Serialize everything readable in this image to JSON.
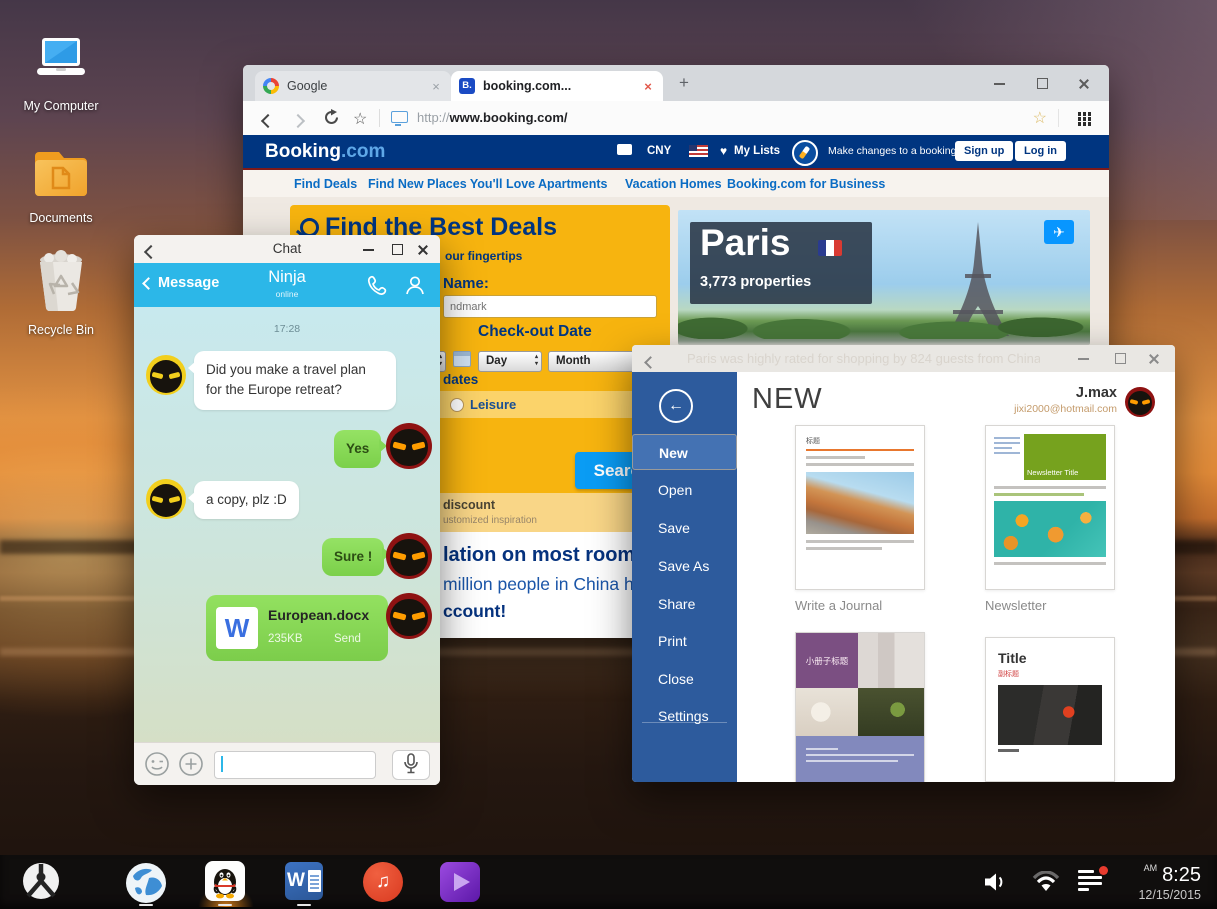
{
  "desktop": {
    "icons": [
      {
        "label": "My Computer"
      },
      {
        "label": "Documents"
      },
      {
        "label": "Recycle Bin"
      }
    ]
  },
  "taskbar": {
    "meridiem": "AM",
    "time": "8:25",
    "date": "12/15/2015"
  },
  "glyphs": {
    "star": "☆",
    "plane": "✈",
    "heart": "♥",
    "music": "♫",
    "plus": "+",
    "back_arrow": "←",
    "w_letter": "W",
    "b_favicon": "B."
  },
  "browser": {
    "tabs": [
      {
        "title": "Google"
      },
      {
        "title": "booking.com..."
      }
    ],
    "url_scheme": "http://",
    "url_host": "www.booking.com/",
    "page": {
      "logo_main": "Booking",
      "logo_suffix": ".com",
      "currency": "CNY",
      "my_lists": "My Lists",
      "make_changes": "Make changes to a booking",
      "sign_up": "Sign up",
      "log_in": "Log in",
      "nav": [
        "Find Deals",
        "Find New Places You'll Love",
        "Apartments",
        "Vacation Homes",
        "Booking.com for Business"
      ],
      "search_box": {
        "title": "Find the Best Deals",
        "subtitle_fragment": "our fingertips",
        "name_label_fragment": "Name:",
        "destination_placeholder_fragment": "ndmark",
        "checkout_label": "Check-out Date",
        "day_select": "Day",
        "month_select": "Month",
        "dates_fragment": "dates",
        "leisure_label": "Leisure",
        "search_button": "Search"
      },
      "deals_strip": {
        "line1_fragment": "discount",
        "line2_fragment": "ustomized inspiration"
      },
      "promo": {
        "line1_fragment": "lation on most rooms!",
        "line2_fragment": "million people in China hav",
        "line3_fragment": "ccount!"
      },
      "paris_banner": {
        "city": "Paris",
        "properties": "3,773 properties"
      }
    }
  },
  "chat": {
    "window_title": "Chat",
    "back_label": "Message",
    "contact_name": "Ninja",
    "status": "online",
    "timestamp": "17:28",
    "messages": {
      "m1": "Did you make a travel plan for the Europe retreat?",
      "m2": "Yes",
      "m3": "a copy, plz :D",
      "m4": "Sure !"
    },
    "file": {
      "name": "European.docx",
      "size": "235KB",
      "action": "Send"
    }
  },
  "word": {
    "titlebar_watermark": "Paris was highly rated for shopping by 824 guests from China!",
    "heading": "NEW",
    "user": {
      "name": "J.max",
      "email": "jixi2000@hotmail.com"
    },
    "menu": [
      "New",
      "Open",
      "Save",
      "Save As",
      "Share",
      "Print",
      "Close",
      "Settings"
    ],
    "templates": {
      "t1": {
        "title": "标题",
        "label": "Write a Journal"
      },
      "t2": {
        "title": "Newsletter Title",
        "label": "Newsletter"
      },
      "t3": {
        "title": "小册子标题"
      },
      "t4": {
        "title": "Title",
        "subtitle": "副标题"
      }
    }
  }
}
